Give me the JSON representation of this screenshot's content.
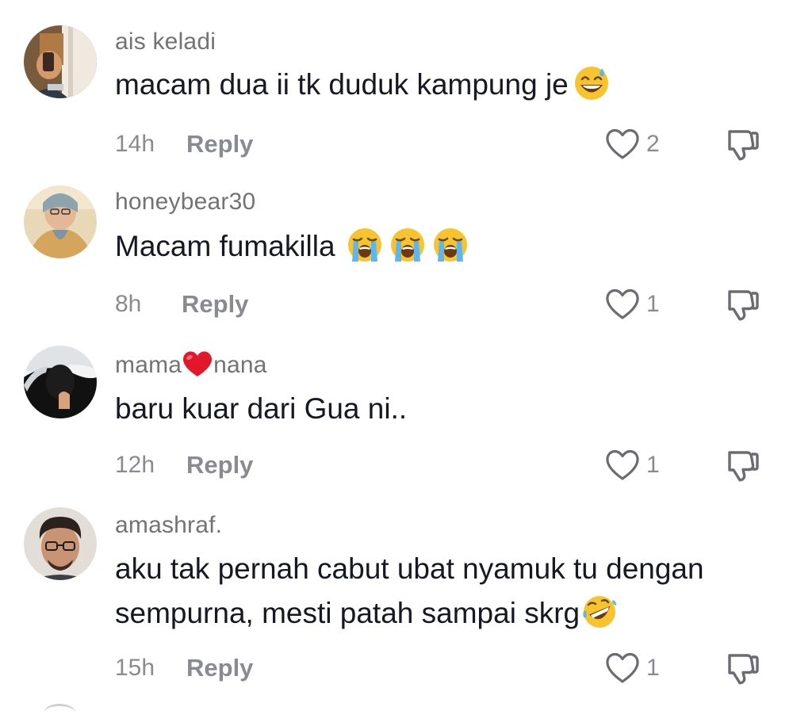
{
  "comments": [
    {
      "username": "ais keladi",
      "text": "macam dua ii tk duduk kampung je",
      "emojis": [
        "grinning-sweat-emoji"
      ],
      "time": "14h",
      "reply_label": "Reply",
      "likes": "2"
    },
    {
      "username": "honeybear30",
      "text": "Macam fumakilla",
      "emojis": [
        "loudly-crying-emoji",
        "loudly-crying-emoji",
        "loudly-crying-emoji"
      ],
      "time": "8h",
      "reply_label": "Reply",
      "likes": "1"
    },
    {
      "username_part1": "mama",
      "username_emoji": "red-heart-emoji",
      "username_part2": "nana",
      "text": "baru kuar dari Gua ni..",
      "time": "12h",
      "reply_label": "Reply",
      "likes": "1"
    },
    {
      "username": "amashraf.",
      "text_line1": "aku tak pernah cabut ubat nyamuk tu dengan",
      "text_line2": "sempurna, mesti patah sampai skrg",
      "emojis": [
        "rolling-laughing-emoji"
      ],
      "time": "15h",
      "reply_label": "Reply",
      "likes": "1"
    }
  ],
  "colors": {
    "username": "#737373",
    "text": "#161823",
    "meta": "#8a8b91",
    "icon": "#6b6c72"
  }
}
